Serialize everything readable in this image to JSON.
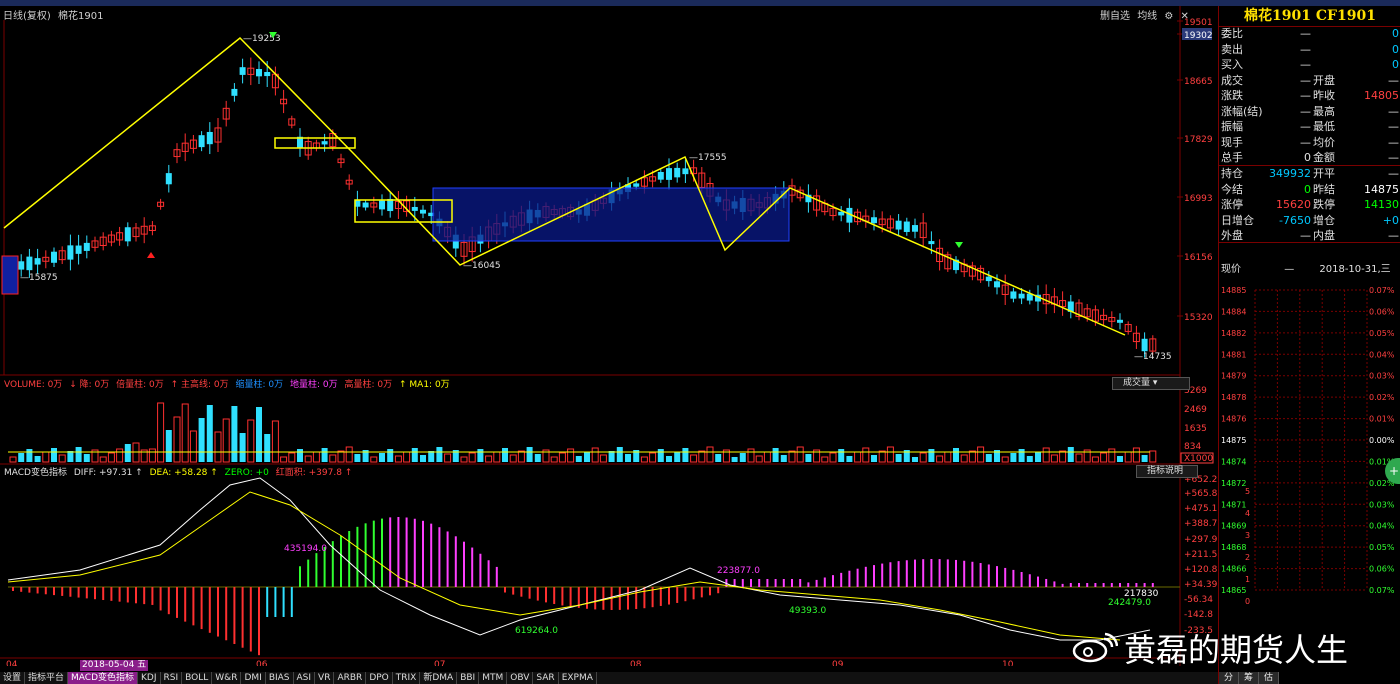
{
  "toolbar": {
    "visible": false
  },
  "chart_header": {
    "period": "日线(复权)",
    "name": "棉花1901"
  },
  "chart_top_right": {
    "items": [
      "删自选",
      "均线"
    ],
    "icons": [
      "settings-icon",
      "close-icon"
    ]
  },
  "price_axis": {
    "ticks": [
      "19501",
      "19302",
      "18665",
      "17829",
      "16993",
      "16156",
      "15320"
    ],
    "highlight": "19302"
  },
  "price_labels": {
    "high": "19253",
    "mid_high": "17555",
    "low1": "16045",
    "start": "15875",
    "last": "14735"
  },
  "volume_legend": [
    {
      "label": "VOLUME: 0万",
      "color": "#ff4040"
    },
    {
      "label": "↓ 降: 0万",
      "color": "#ff4040"
    },
    {
      "label": "倍量柱: 0万",
      "color": "#ff4040"
    },
    {
      "label": "↑ 主高线: 0万",
      "color": "#ff4040"
    },
    {
      "label": "缩量柱: 0万",
      "color": "#1e90ff"
    },
    {
      "label": "地量柱: 0万",
      "color": "#ff40ff"
    },
    {
      "label": "高量柱: 0万",
      "color": "#ff4040"
    },
    {
      "label": "↑ MA1: 0万",
      "color": "#ffff00"
    }
  ],
  "volume_axis": {
    "ticks": [
      "3269",
      "2469",
      "1635",
      "834",
      "X1000"
    ]
  },
  "volume_button": "成交量",
  "macd_legend": [
    {
      "label": "MACD变色指标",
      "color": "#e0e0e0"
    },
    {
      "label": "DIFF: +97.31 ↑",
      "color": "#e0e0e0"
    },
    {
      "label": "DEA: +58.28 ↑",
      "color": "#ffff00"
    },
    {
      "label": "ZERO: +0",
      "color": "#00ff00"
    },
    {
      "label": "红面积: +397.8 ↑",
      "color": "#ff4040"
    }
  ],
  "macd_button": "指标说明",
  "macd_axis": {
    "ticks": [
      "+652.2",
      "+565.8",
      "+475.1",
      "+388.7",
      "+297.9",
      "+211.5",
      "+120.8",
      "+34.39",
      "-56.34",
      "-142.8",
      "-233.5"
    ]
  },
  "macd_labels": {
    "area1": "435194.0",
    "area2": "619264.0",
    "area3": "223877.0",
    "area4": "49393.0",
    "area5": "242479.0",
    "area6": "217830"
  },
  "x_axis": {
    "months": [
      "04",
      "05",
      "06",
      "07",
      "08",
      "09",
      "10"
    ],
    "selected_date": "2018-05-04 五"
  },
  "tabs": [
    "设置",
    "指标平台",
    "MACD变色指标",
    "KDJ",
    "RSI",
    "BOLL",
    "W&R",
    "DMI",
    "BIAS",
    "ASI",
    "VR",
    "ARBR",
    "DPO",
    "TRIX",
    "新DMA",
    "BBI",
    "MTM",
    "OBV",
    "SAR",
    "EXPMA"
  ],
  "tabs_active": "MACD变色指标",
  "right_panel": {
    "title": "棉花1901 CF1901",
    "rows1": [
      {
        "k": "委比",
        "v": "—",
        "k2": "",
        "v2": "0",
        "c": "#00c8ff"
      },
      {
        "k": "卖出",
        "v": "—",
        "k2": "",
        "v2": "0",
        "c": "#00c8ff"
      },
      {
        "k": "买入",
        "v": "—",
        "k2": "",
        "v2": "0",
        "c": "#00c8ff"
      },
      {
        "k": "成交",
        "v": "—",
        "k2": "开盘",
        "v2": "—",
        "c": "#e0e0e0"
      },
      {
        "k": "涨跌",
        "v": "—",
        "k2": "昨收",
        "v2": "14805",
        "c": "#ff4040"
      },
      {
        "k": "涨幅(结)",
        "v": "—",
        "k2": "最高",
        "v2": "—",
        "c": "#e0e0e0"
      },
      {
        "k": "振幅",
        "v": "—",
        "k2": "最低",
        "v2": "—",
        "c": "#e0e0e0"
      },
      {
        "k": "现手",
        "v": "—",
        "k2": "均价",
        "v2": "—",
        "c": "#e0e0e0"
      },
      {
        "k": "总手",
        "v": "0",
        "k2": "金额",
        "v2": "—",
        "c": "#e0e0e0"
      }
    ],
    "rows2": [
      {
        "k": "持仓",
        "v": "349932",
        "vc": "#00c8ff",
        "k2": "开平",
        "v2": "—",
        "c": "#e0e0e0"
      },
      {
        "k": "今结",
        "v": "0",
        "vc": "#00ff00",
        "k2": "昨结",
        "v2": "14875",
        "c": "#ffffff"
      },
      {
        "k": "涨停",
        "v": "15620",
        "vc": "#ff4040",
        "k2": "跌停",
        "v2": "14130",
        "c": "#00ff00"
      },
      {
        "k": "日增仓",
        "v": "-7650",
        "vc": "#00c8ff",
        "k2": "增仓",
        "v2": "+0",
        "c": "#00c8ff"
      },
      {
        "k": "外盘",
        "v": "—",
        "vc": "#e0e0e0",
        "k2": "内盘",
        "v2": "—",
        "c": "#e0e0e0"
      }
    ],
    "now_label": "现价",
    "now_value": "—",
    "now_date": "2018-10-31,三",
    "grid_prices": [
      "14885",
      "14884",
      "14882",
      "14881",
      "14879",
      "14878",
      "14876",
      "14875",
      "14874",
      "14872",
      "14871",
      "14869",
      "14868",
      "14866",
      "14865"
    ],
    "grid_pcts": [
      "0.07%",
      "0.06%",
      "0.05%",
      "0.04%",
      "0.03%",
      "0.02%",
      "0.01%",
      "0.00%",
      "0.01%",
      "0.02%",
      "0.03%",
      "0.04%",
      "0.05%",
      "0.06%",
      "0.07%"
    ],
    "grid_counts": [
      "5",
      "4",
      "3",
      "2",
      "1",
      "0"
    ],
    "bottom_tabs": [
      "分",
      "筹",
      "估"
    ]
  },
  "watermark": "黄磊的期货人生"
}
